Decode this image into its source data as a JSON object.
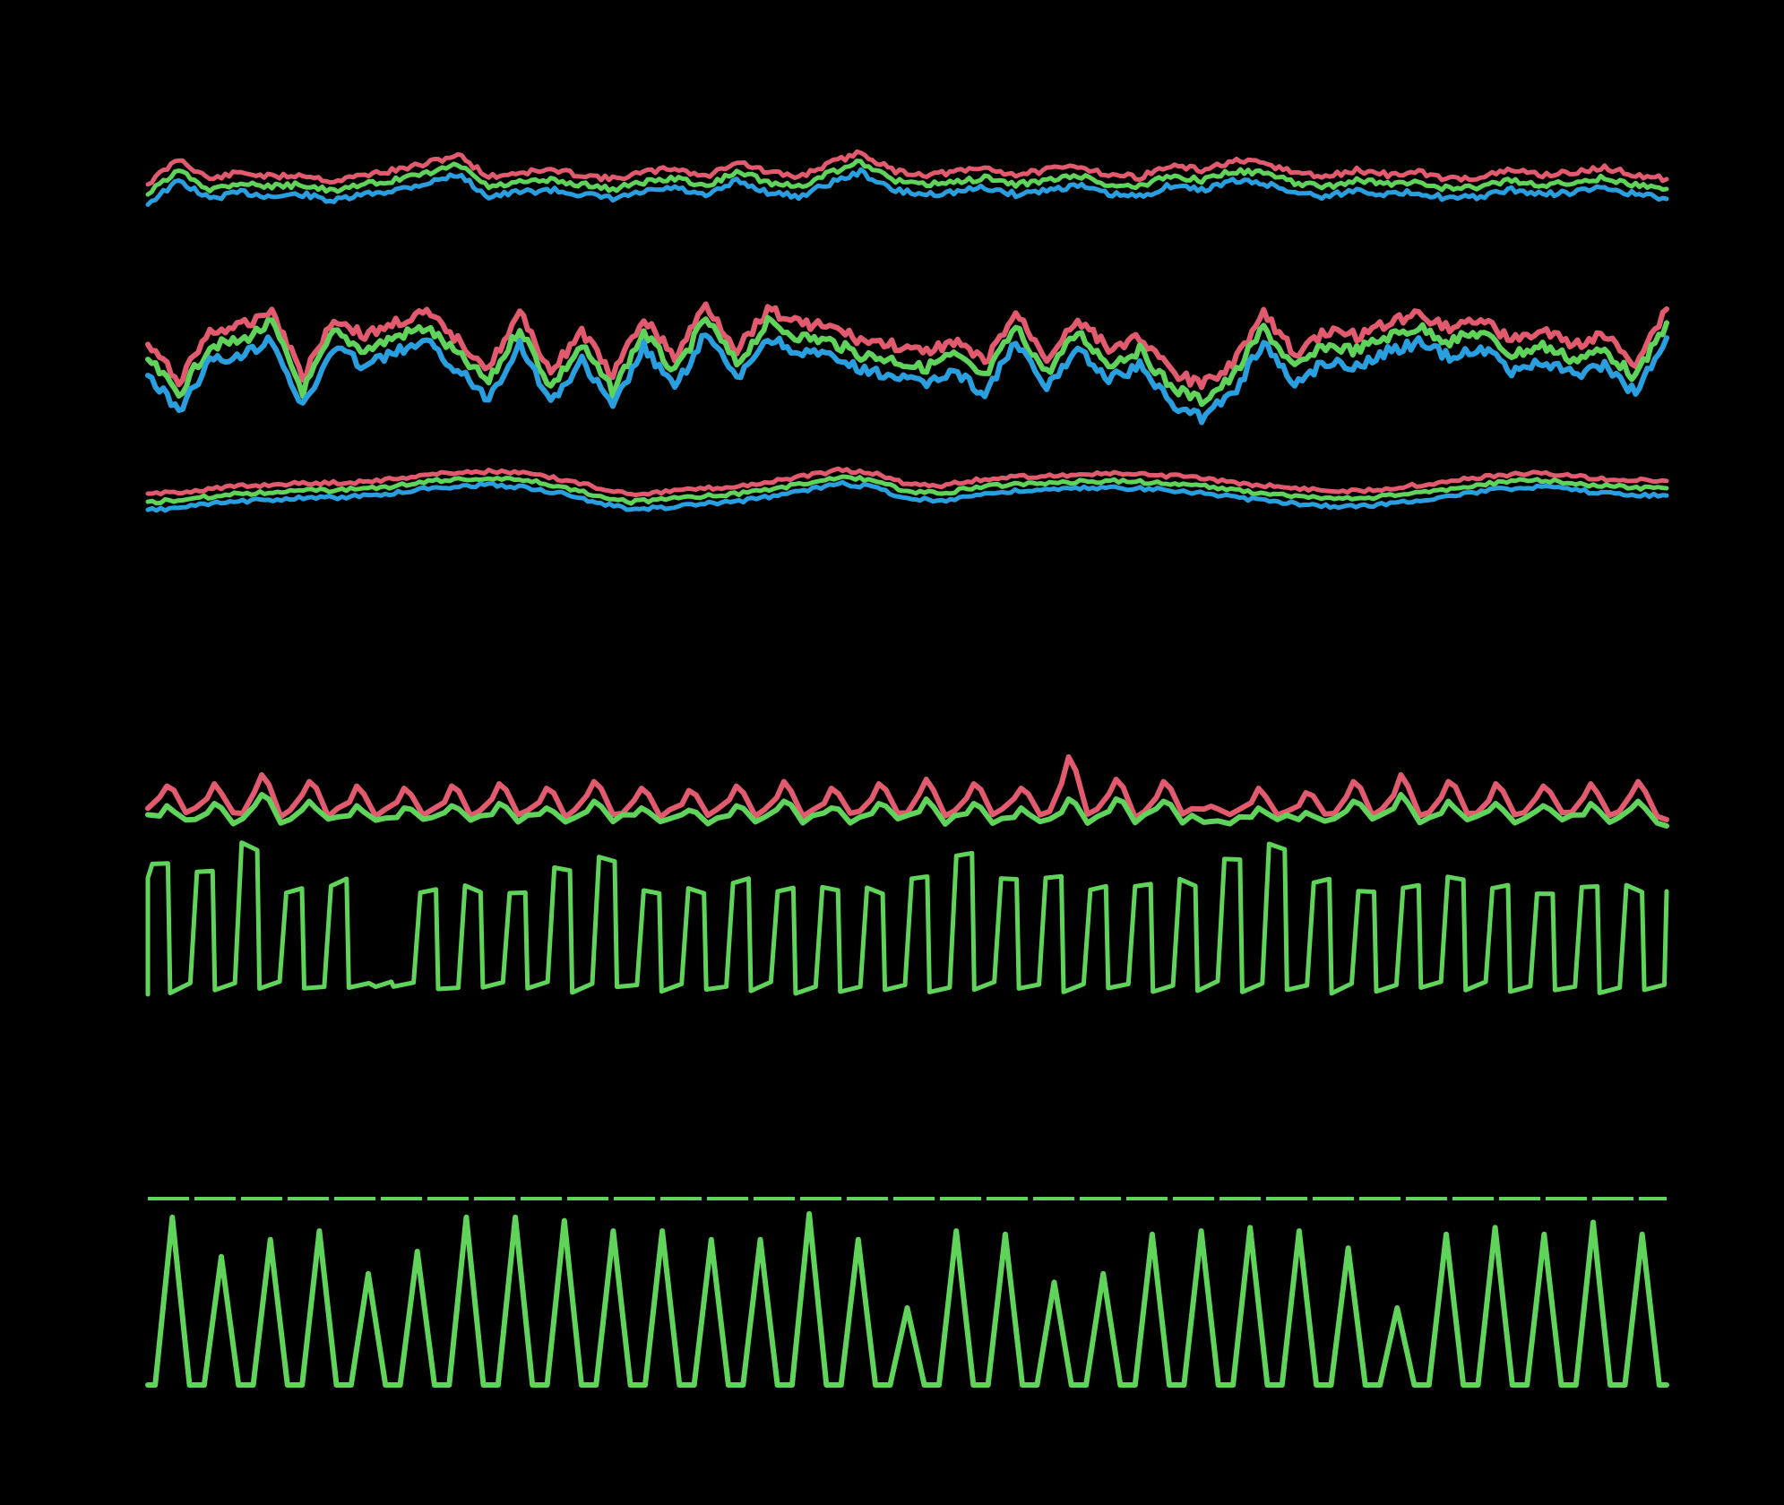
{
  "chart_data": [
    {
      "type": "line",
      "x": [
        0,
        100
      ],
      "series": [
        {
          "color": "#e25a6e",
          "values": [
            0.3,
            0.85,
            0.4,
            0.55,
            0.45,
            0.5,
            0.35,
            0.5,
            0.6,
            0.75,
            0.95,
            0.45,
            0.55,
            0.6,
            0.5,
            0.4,
            0.55,
            0.65,
            0.45,
            0.8,
            0.55,
            0.45,
            0.75,
            1.0,
            0.6,
            0.5,
            0.55,
            0.65,
            0.5,
            0.6,
            0.7,
            0.5,
            0.45,
            0.7,
            0.6,
            0.8,
            0.75,
            0.55,
            0.45,
            0.6,
            0.5,
            0.55,
            0.4,
            0.45,
            0.6,
            0.5,
            0.55,
            0.65,
            0.5,
            0.4
          ]
        },
        {
          "color": "#5fd35a",
          "values": [
            0.2,
            0.72,
            0.3,
            0.45,
            0.35,
            0.4,
            0.25,
            0.4,
            0.5,
            0.65,
            0.85,
            0.35,
            0.45,
            0.5,
            0.4,
            0.3,
            0.45,
            0.55,
            0.35,
            0.7,
            0.45,
            0.35,
            0.65,
            0.9,
            0.5,
            0.4,
            0.45,
            0.55,
            0.4,
            0.5,
            0.6,
            0.4,
            0.35,
            0.6,
            0.5,
            0.7,
            0.65,
            0.45,
            0.35,
            0.5,
            0.4,
            0.45,
            0.3,
            0.35,
            0.5,
            0.4,
            0.45,
            0.55,
            0.4,
            0.3
          ]
        },
        {
          "color": "#2a9fe0",
          "values": [
            0.1,
            0.6,
            0.2,
            0.35,
            0.25,
            0.3,
            0.15,
            0.3,
            0.4,
            0.55,
            0.75,
            0.25,
            0.35,
            0.4,
            0.3,
            0.2,
            0.35,
            0.45,
            0.25,
            0.6,
            0.35,
            0.25,
            0.55,
            0.8,
            0.4,
            0.3,
            0.35,
            0.45,
            0.3,
            0.4,
            0.5,
            0.3,
            0.25,
            0.5,
            0.4,
            0.6,
            0.55,
            0.35,
            0.25,
            0.4,
            0.3,
            0.35,
            0.2,
            0.25,
            0.4,
            0.3,
            0.35,
            0.45,
            0.3,
            0.2
          ]
        }
      ]
    },
    {
      "type": "line",
      "x": [
        0,
        100
      ],
      "series": [
        {
          "color": "#e25a6e",
          "values": [
            0.45,
            0.05,
            0.6,
            0.65,
            0.85,
            0.1,
            0.75,
            0.55,
            0.7,
            0.8,
            0.5,
            0.2,
            0.8,
            0.15,
            0.6,
            0.1,
            0.75,
            0.3,
            0.9,
            0.4,
            0.85,
            0.7,
            0.65,
            0.5,
            0.45,
            0.35,
            0.5,
            0.25,
            0.8,
            0.3,
            0.75,
            0.4,
            0.55,
            0.15,
            0.0,
            0.25,
            0.8,
            0.35,
            0.6,
            0.55,
            0.7,
            0.8,
            0.65,
            0.75,
            0.5,
            0.6,
            0.45,
            0.55,
            0.25,
            0.85
          ]
        },
        {
          "color": "#5fd35a",
          "values": [
            0.38,
            0.0,
            0.53,
            0.58,
            0.78,
            0.03,
            0.68,
            0.48,
            0.63,
            0.73,
            0.43,
            0.13,
            0.73,
            0.08,
            0.53,
            0.03,
            0.68,
            0.23,
            0.83,
            0.33,
            0.78,
            0.63,
            0.58,
            0.43,
            0.38,
            0.28,
            0.43,
            0.18,
            0.73,
            0.23,
            0.68,
            0.33,
            0.48,
            0.08,
            -0.07,
            0.18,
            0.73,
            0.28,
            0.53,
            0.48,
            0.63,
            0.73,
            0.58,
            0.68,
            0.43,
            0.53,
            0.38,
            0.48,
            0.18,
            0.78
          ]
        },
        {
          "color": "#2a9fe0",
          "values": [
            0.3,
            -0.08,
            0.45,
            0.5,
            0.7,
            -0.05,
            0.6,
            0.4,
            0.55,
            0.65,
            0.35,
            0.05,
            0.65,
            0.0,
            0.45,
            -0.05,
            0.6,
            0.15,
            0.75,
            0.25,
            0.7,
            0.55,
            0.5,
            0.35,
            0.3,
            0.2,
            0.35,
            0.1,
            0.65,
            0.15,
            0.6,
            0.25,
            0.4,
            0.0,
            -0.15,
            0.1,
            0.65,
            0.2,
            0.45,
            0.4,
            0.55,
            0.65,
            0.5,
            0.6,
            0.35,
            0.45,
            0.3,
            0.4,
            0.1,
            0.7
          ]
        }
      ]
    },
    {
      "type": "line",
      "x": [
        0,
        100
      ],
      "series": [
        {
          "color": "#e25a6e",
          "values": [
            0.2,
            0.28,
            0.38,
            0.45,
            0.5,
            0.52,
            0.55,
            0.62,
            0.75,
            0.82,
            0.85,
            0.78,
            0.62,
            0.4,
            0.22,
            0.28,
            0.36,
            0.42,
            0.55,
            0.7,
            0.88,
            0.8,
            0.5,
            0.45,
            0.6,
            0.68,
            0.72,
            0.76,
            0.78,
            0.74,
            0.7,
            0.58,
            0.48,
            0.4,
            0.32,
            0.3,
            0.38,
            0.48,
            0.6,
            0.72,
            0.8,
            0.75,
            0.65,
            0.6,
            0.58
          ]
        },
        {
          "color": "#5fd35a",
          "values": [
            0.12,
            0.2,
            0.3,
            0.37,
            0.42,
            0.44,
            0.47,
            0.54,
            0.67,
            0.74,
            0.77,
            0.7,
            0.54,
            0.32,
            0.14,
            0.2,
            0.28,
            0.34,
            0.47,
            0.62,
            0.8,
            0.72,
            0.42,
            0.37,
            0.52,
            0.6,
            0.64,
            0.68,
            0.7,
            0.66,
            0.62,
            0.5,
            0.4,
            0.32,
            0.24,
            0.22,
            0.3,
            0.4,
            0.52,
            0.64,
            0.72,
            0.67,
            0.57,
            0.52,
            0.5
          ]
        },
        {
          "color": "#2a9fe0",
          "values": [
            0.05,
            0.13,
            0.23,
            0.3,
            0.35,
            0.37,
            0.4,
            0.47,
            0.6,
            0.67,
            0.7,
            0.63,
            0.47,
            0.25,
            0.07,
            0.13,
            0.21,
            0.27,
            0.4,
            0.55,
            0.73,
            0.65,
            0.35,
            0.3,
            0.45,
            0.53,
            0.57,
            0.61,
            0.63,
            0.59,
            0.55,
            0.43,
            0.33,
            0.25,
            0.17,
            0.15,
            0.23,
            0.33,
            0.45,
            0.57,
            0.65,
            0.6,
            0.5,
            0.45,
            0.43
          ]
        }
      ]
    },
    {
      "type": "line",
      "x": [
        0,
        100
      ],
      "series": [
        {
          "color": "#e25a6e",
          "peak_count": 32,
          "peak_values": [
            0.75,
            0.8,
            1.0,
            0.85,
            0.75,
            0.7,
            0.75,
            0.8,
            0.7,
            0.85,
            0.7,
            0.65,
            0.75,
            0.85,
            0.7,
            0.8,
            0.9,
            0.8,
            0.7,
            1.4,
            0.9,
            0.85,
            0.3,
            0.7,
            0.6,
            0.85,
            1.0,
            0.85,
            0.8,
            0.75,
            0.8,
            0.85
          ]
        },
        {
          "color": "#5fd35a",
          "peak_count": 32,
          "peak_values": [
            0.45,
            0.5,
            0.7,
            0.55,
            0.45,
            0.4,
            0.45,
            0.5,
            0.4,
            0.55,
            0.4,
            0.35,
            0.45,
            0.55,
            0.4,
            0.5,
            0.6,
            0.5,
            0.4,
            0.6,
            0.6,
            0.55,
            0.1,
            0.4,
            0.3,
            0.55,
            0.7,
            0.55,
            0.5,
            0.45,
            0.5,
            0.55
          ]
        }
      ]
    },
    {
      "type": "line",
      "x": [
        0,
        100
      ],
      "series": [
        {
          "color": "#5fd35a",
          "pulse_count": 34,
          "pulse_values": [
            0.9,
            0.85,
            1.0,
            0.7,
            0.75,
            0.0,
            0.7,
            0.7,
            0.7,
            0.85,
            0.9,
            0.7,
            0.7,
            0.75,
            0.7,
            0.7,
            0.7,
            0.8,
            0.95,
            0.8,
            0.8,
            0.7,
            0.75,
            0.75,
            0.9,
            1.0,
            0.75,
            0.7,
            0.7,
            0.8,
            0.7,
            0.7,
            0.7,
            0.7
          ]
        }
      ]
    },
    {
      "type": "line",
      "x": [
        0,
        100
      ],
      "series": [
        {
          "color": "#5fd35a",
          "peak_count": 31,
          "peak_values": [
            0.98,
            0.75,
            0.85,
            0.9,
            0.65,
            0.78,
            0.98,
            0.98,
            0.96,
            0.9,
            0.9,
            0.85,
            0.85,
            1.0,
            0.85,
            0.45,
            0.9,
            0.88,
            0.6,
            0.65,
            0.88,
            0.9,
            0.92,
            0.9,
            0.8,
            0.45,
            0.88,
            0.92,
            0.88,
            0.95,
            0.88
          ]
        }
      ]
    }
  ]
}
